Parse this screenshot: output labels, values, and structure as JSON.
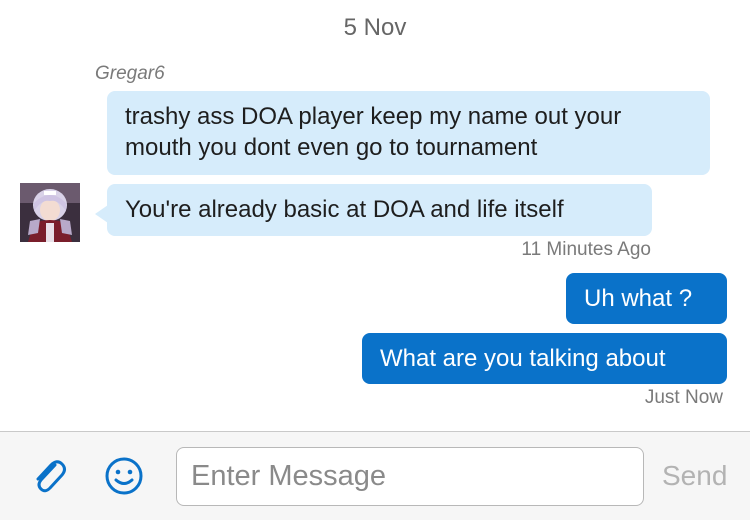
{
  "chat": {
    "date_header": "5 Nov",
    "sender_name": "Gregar6",
    "messages": [
      {
        "direction": "incoming",
        "text": "trashy ass DOA player keep my name out your mouth you dont even go to tournament"
      },
      {
        "direction": "incoming",
        "text": "You're already basic at DOA and life itself"
      },
      {
        "direction": "outgoing",
        "text": "Uh what ?"
      },
      {
        "direction": "outgoing",
        "text": "What are you talking about"
      }
    ],
    "incoming_timestamp": "11 Minutes Ago",
    "outgoing_timestamp": "Just Now"
  },
  "composer": {
    "attach_icon": "paperclip-icon",
    "emoji_icon": "smiley-icon",
    "input_value": "",
    "input_placeholder": "Enter Message",
    "send_label": "Send"
  },
  "colors": {
    "incoming_bubble": "#d6ecfb",
    "outgoing_bubble": "#0a72c9",
    "icon_blue": "#0a72c9",
    "send_disabled": "#b3b3b3"
  }
}
